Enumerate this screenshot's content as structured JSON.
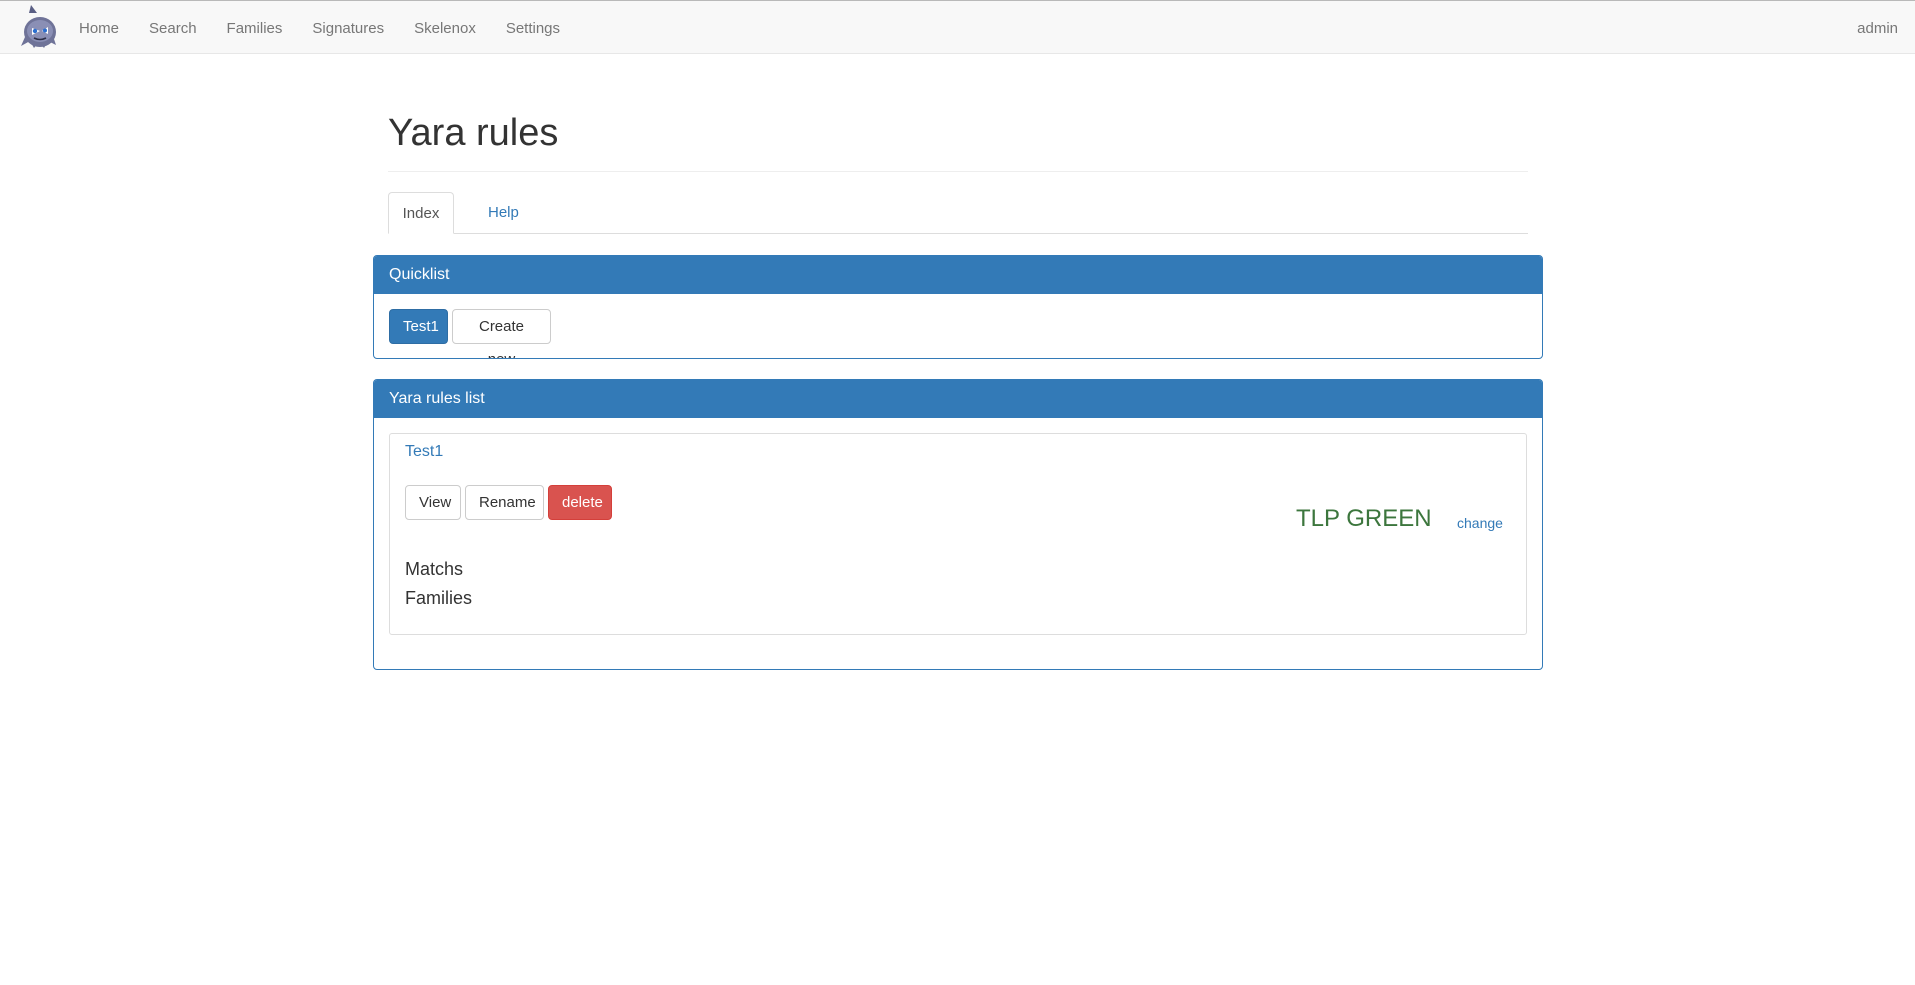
{
  "nav": {
    "items": [
      {
        "label": "Home"
      },
      {
        "label": "Search"
      },
      {
        "label": "Families"
      },
      {
        "label": "Signatures"
      },
      {
        "label": "Skelenox"
      },
      {
        "label": "Settings"
      }
    ],
    "user": "admin"
  },
  "page": {
    "title": "Yara rules"
  },
  "tabs": [
    {
      "label": "Index",
      "active": true
    },
    {
      "label": "Help",
      "active": false
    }
  ],
  "quicklist": {
    "heading": "Quicklist",
    "items": [
      {
        "label": "Test1"
      }
    ],
    "create_label": "Create new"
  },
  "rules_list": {
    "heading": "Yara rules list",
    "rules": [
      {
        "name": "Test1",
        "view_label": "View",
        "rename_label": "Rename",
        "delete_label": "delete",
        "tlp": "TLP GREEN",
        "tlp_change_label": "change",
        "matchs_label": "Matchs",
        "families_label": "Families"
      }
    ]
  },
  "colors": {
    "primary": "#337ab7",
    "danger": "#d9534f",
    "tlp_green": "#3c763d",
    "navbar_bg": "#f8f8f8"
  }
}
